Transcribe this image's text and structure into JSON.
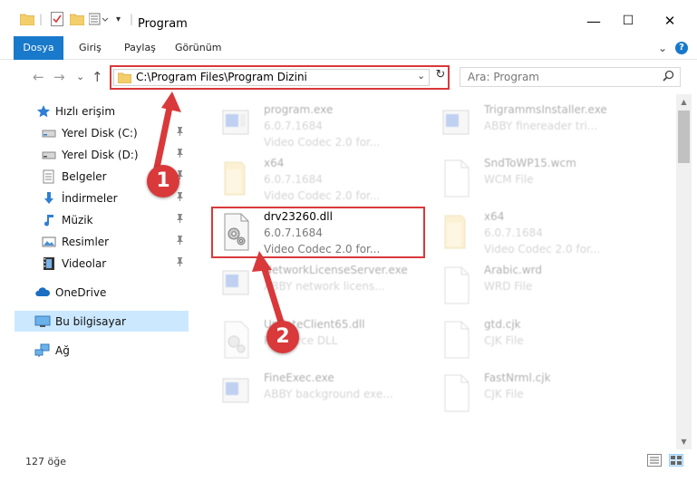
{
  "window": {
    "title": "Program",
    "minimize": "—",
    "maximize": "☐",
    "close": "✕"
  },
  "ribbon": {
    "tabs": [
      "Dosya",
      "Giriş",
      "Paylaş",
      "Görünüm"
    ],
    "collapse_chevron": "⌄",
    "help": "?"
  },
  "address": {
    "back": "←",
    "forward": "→",
    "recent": "⌄",
    "up": "↑",
    "path": "C:\\Program Files\\Program Dizini",
    "dropdown": "⌄",
    "refresh": "↻"
  },
  "search": {
    "placeholder": "Ara: Program",
    "icon": "search-icon"
  },
  "sidebar": {
    "items": [
      {
        "label": "Hızlı erişim",
        "icon": "star-icon"
      },
      {
        "label": "Yerel Disk (C:)",
        "icon": "drive-icon",
        "pinned": true
      },
      {
        "label": "Yerel Disk (D:)",
        "icon": "drive-icon",
        "pinned": true
      },
      {
        "label": "Belgeler",
        "icon": "documents-icon",
        "pinned": true
      },
      {
        "label": "İndirmeler",
        "icon": "download-icon",
        "pinned": true
      },
      {
        "label": "Müzik",
        "icon": "music-icon",
        "pinned": true
      },
      {
        "label": "Resimler",
        "icon": "pictures-icon",
        "pinned": true
      },
      {
        "label": "Videolar",
        "icon": "videos-icon",
        "pinned": true
      },
      {
        "label": "OneDrive",
        "icon": "onedrive-icon"
      },
      {
        "label": "Bu bilgisayar",
        "icon": "computer-icon",
        "selected": true
      },
      {
        "label": "Ağ",
        "icon": "network-icon"
      }
    ],
    "pin_glyph": "📌"
  },
  "files": {
    "left": [
      {
        "name": "program.exe",
        "line2": "6.0.7.1684",
        "line3": "Video Codec 2.0 for...",
        "icon": "exe-icon"
      },
      {
        "name": "x64",
        "line2": "6.0.7.1684",
        "line3": "Video Codec 2.0 for...",
        "icon": "folder-icon"
      },
      {
        "name": "drv23260.dll",
        "line2": "6.0.7.1684",
        "line3": "Video Codec 2.0 for...",
        "icon": "dll-gear-icon"
      },
      {
        "name": "NetworkLicenseServer.exe",
        "line2": "ABBY network licens...",
        "line3": "",
        "icon": "exe-icon"
      },
      {
        "name": "UpdateClient65.dll",
        "line2": "Resource DLL",
        "line3": "",
        "icon": "dll-gear-icon"
      },
      {
        "name": "FineExec.exe",
        "line2": "ABBY background exe...",
        "line3": "",
        "icon": "exe-icon"
      }
    ],
    "right": [
      {
        "name": "TrigrammsInstaller.exe",
        "line2": "ABBY finereader tri...",
        "line3": "",
        "icon": "exe-icon"
      },
      {
        "name": "SndToWP15.wcm",
        "line2": "WCM File",
        "line3": "",
        "icon": "file-icon"
      },
      {
        "name": "x64",
        "line2": "6.0.7.1684",
        "line3": "Video Codec 2.0 for...",
        "icon": "folder-icon"
      },
      {
        "name": "Arabic.wrd",
        "line2": "WRD File",
        "line3": "",
        "icon": "file-icon"
      },
      {
        "name": "gtd.cjk",
        "line2": "CJK File",
        "line3": "",
        "icon": "file-icon"
      },
      {
        "name": "FastNrml.cjk",
        "line2": "CJK File",
        "line3": "",
        "icon": "file-icon"
      }
    ]
  },
  "status": {
    "count": "127 öğe"
  },
  "annotations": {
    "badge1": "1",
    "badge2": "2",
    "color": "#d9393a"
  },
  "colors": {
    "accent": "#1979ca",
    "selected": "#cce8ff",
    "annotation": "#d9393a"
  }
}
